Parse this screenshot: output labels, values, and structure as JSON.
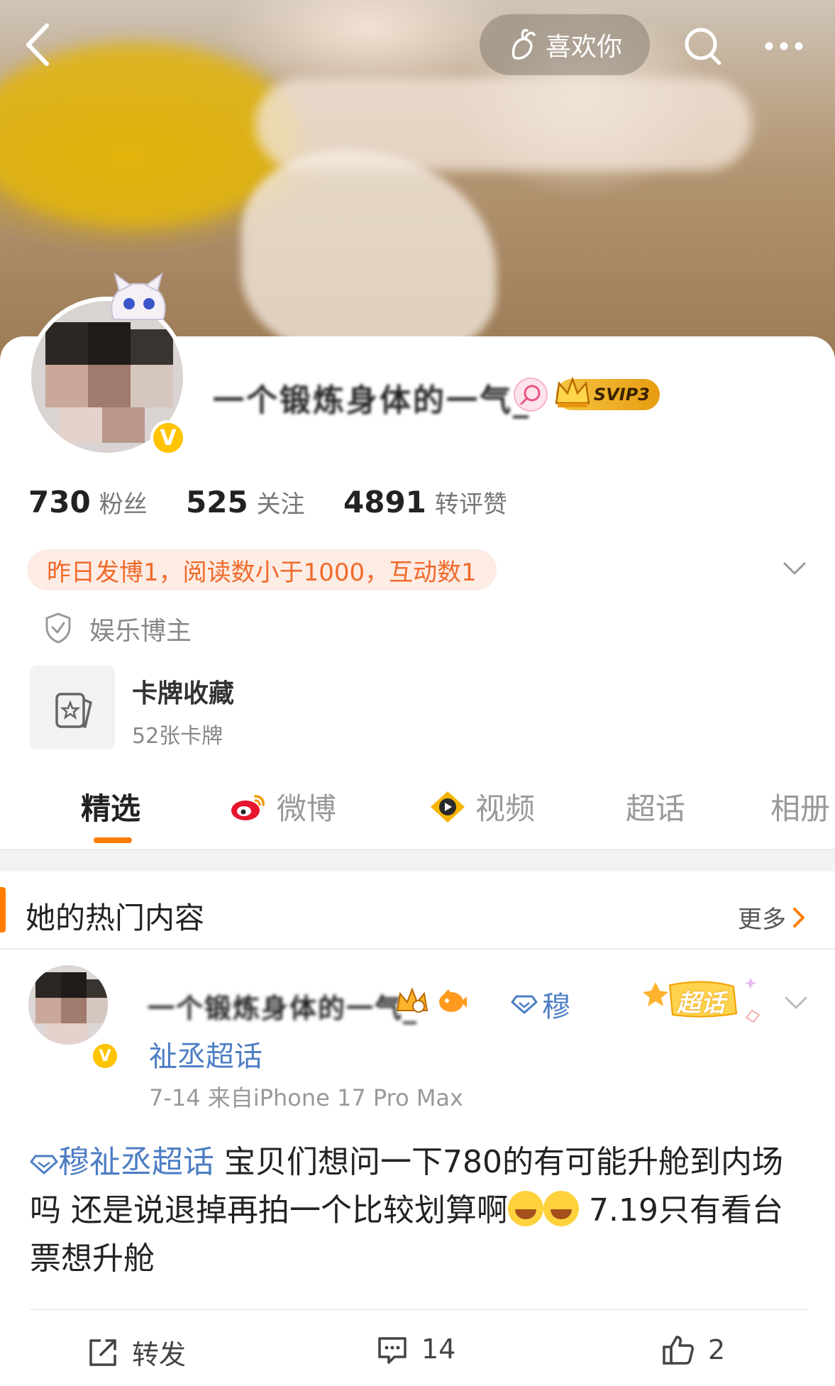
{
  "header": {
    "like_label": "喜欢你"
  },
  "profile": {
    "username": "一个锻炼身体的一气_",
    "vip_badge": "SVIP3",
    "verified_mark": "V",
    "stats": [
      {
        "value": "730",
        "label": "粉丝"
      },
      {
        "value": "525",
        "label": "关注"
      },
      {
        "value": "4891",
        "label": "转评赞"
      }
    ],
    "info_pill": "昨日发博1，阅读数小于1000，互动数1",
    "tag": "娱乐博主",
    "card_collection": {
      "title": "卡牌收藏",
      "subtitle": "52张卡牌"
    }
  },
  "tabs": [
    {
      "label": "精选",
      "icon": "",
      "active": true
    },
    {
      "label": "微博",
      "icon": "weibo-icon"
    },
    {
      "label": "视频",
      "icon": "video-icon"
    },
    {
      "label": "超话",
      "icon": ""
    },
    {
      "label": "相册",
      "icon": ""
    }
  ],
  "hot_section": {
    "title": "她的热门内容",
    "more": "更多"
  },
  "post": {
    "author": "一个锻炼身体的一气_",
    "topic_prefix": "穆",
    "topic_line": "祉丞超话",
    "meta": "7-14   来自iPhone 17 Pro Max",
    "sticker": "超话",
    "text_topic": "穆祉丞超话",
    "text_part1": " 宝贝们想问一下780的有可能升舱到内场吗 还是说退掉再拍一个比较划算啊",
    "text_part2": " 7.19只有看台票想升舱",
    "actions": {
      "repost": "转发",
      "comments": "14",
      "likes": "2"
    }
  },
  "colors": {
    "accent": "#ff7d00",
    "link": "#4d7ec4",
    "info_text": "#f06a2a",
    "info_bg": "#fdece4"
  }
}
